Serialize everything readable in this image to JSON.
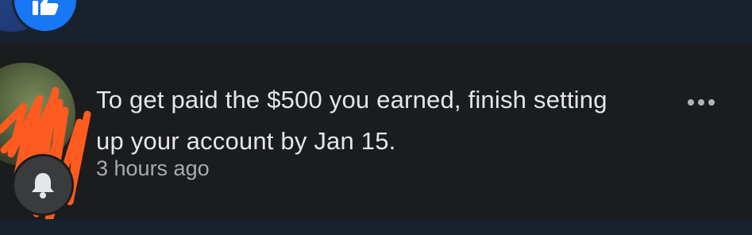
{
  "previous_notification": {
    "badge_icon": "like-icon",
    "badge_color": "#1877f2"
  },
  "notification": {
    "message": "To get paid the $500 you earned, finish setting up your account by Jan 15.",
    "time": "3 hours ago",
    "badge_icon": "bell-icon",
    "avatar_redacted": true,
    "more_icon": "more-horizontal-icon"
  },
  "colors": {
    "background": "#18222f",
    "notification_row": "#1b1c1e",
    "text_primary": "#e4e6eb",
    "text_secondary": "#a8abaf",
    "redaction_scribble": "#ff5a1f"
  }
}
